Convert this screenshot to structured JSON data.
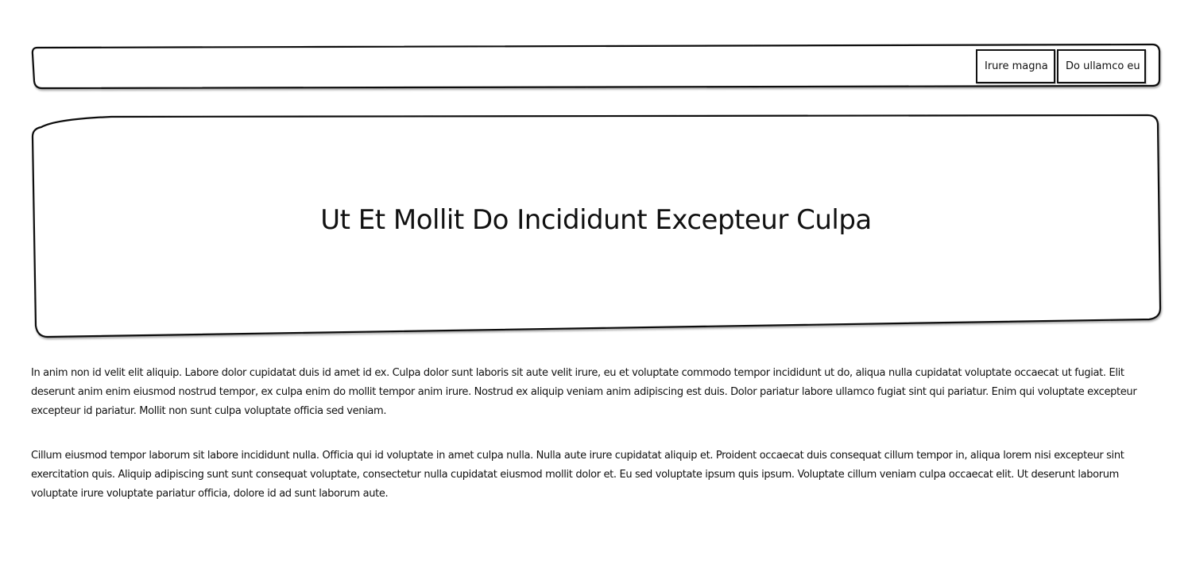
{
  "nav": {
    "buttons": [
      {
        "label": "Irure magna"
      },
      {
        "label": "Do ullamco eu"
      }
    ]
  },
  "hero": {
    "title": "Ut Et Mollit Do Incididunt Excepteur Culpa"
  },
  "content": {
    "paragraphs": [
      "In anim non id velit elit aliquip. Labore dolor cupidatat duis id amet id ex. Culpa dolor sunt laboris sit aute velit irure, eu et voluptate commodo tempor incididunt ut do, aliqua nulla cupidatat voluptate occaecat ut fugiat. Elit deserunt anim enim eiusmod nostrud tempor, ex culpa enim do mollit tempor anim irure. Nostrud ex aliquip veniam anim adipiscing est duis. Dolor pariatur labore ullamco fugiat sint qui pariatur. Enim qui voluptate excepteur excepteur id pariatur. Mollit non sunt culpa voluptate officia sed veniam.",
      "Cillum eiusmod tempor laborum sit labore incididunt nulla. Officia qui id voluptate in amet culpa nulla. Nulla aute irure cupidatat aliquip et. Proident occaecat duis consequat cillum tempor in, aliqua lorem nisi excepteur sint exercitation quis. Aliquip adipiscing sunt sunt consequat voluptate, consectetur nulla cupidatat eiusmod mollit dolor et. Eu sed voluptate ipsum quis ipsum. Voluptate cillum veniam culpa occaecat elit. Ut deserunt laborum voluptate irure voluptate pariatur officia, dolore id ad sunt laborum aute."
    ]
  },
  "colors": {
    "ink": "#111111",
    "background": "#ffffff"
  }
}
